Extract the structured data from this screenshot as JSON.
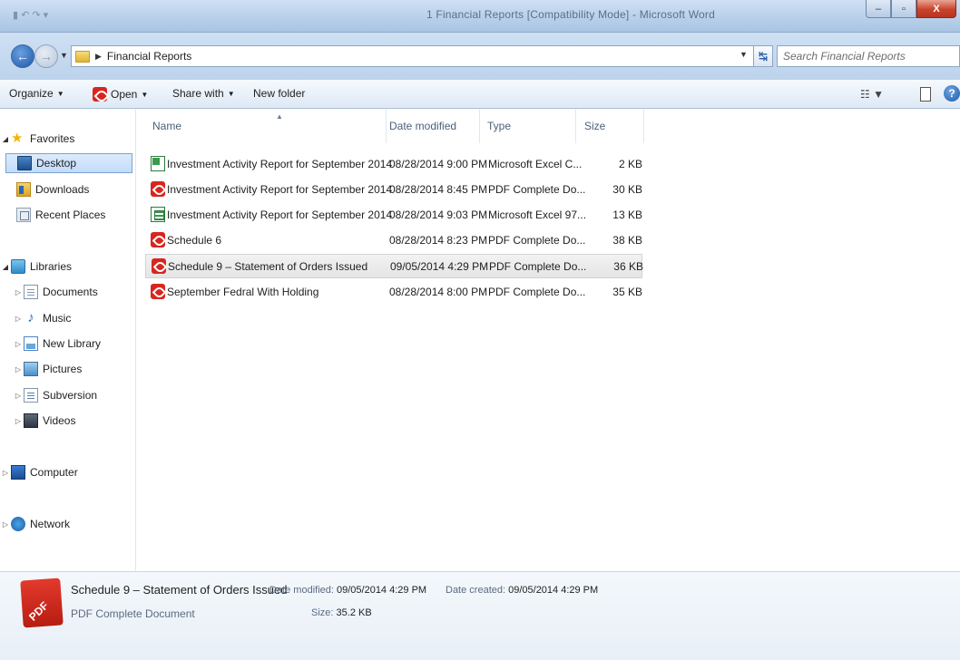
{
  "window": {
    "doc_title": "1 Financial Reports [Compatibility Mode] - Microsoft Word",
    "minimize": "–",
    "maximize": "▫",
    "close": "X"
  },
  "address": {
    "path": "Financial Reports",
    "search_placeholder": "Search Financial Reports"
  },
  "commands": {
    "organize": "Organize",
    "open": "Open",
    "share_with": "Share with",
    "new_folder": "New folder"
  },
  "nav": {
    "favorites": "Favorites",
    "desktop": "Desktop",
    "downloads": "Downloads",
    "recent_places": "Recent Places",
    "libraries": "Libraries",
    "documents": "Documents",
    "music": "Music",
    "new_library": "New Library",
    "pictures": "Pictures",
    "subversion": "Subversion",
    "videos": "Videos",
    "computer": "Computer",
    "network": "Network"
  },
  "columns": {
    "name": "Name",
    "date_modified": "Date modified",
    "type": "Type",
    "size": "Size"
  },
  "files": [
    {
      "name": "Investment Activity Report for September 2014",
      "date": "08/28/2014 9:00 PM",
      "type": "Microsoft Excel C...",
      "size": "2 KB",
      "icon": "excel-csv-icon"
    },
    {
      "name": "Investment Activity Report for September 2014",
      "date": "08/28/2014 8:45 PM",
      "type": "PDF Complete Do...",
      "size": "30 KB",
      "icon": "pdf-icon"
    },
    {
      "name": "Investment Activity Report for September 2014",
      "date": "08/28/2014 9:03 PM",
      "type": "Microsoft Excel 97...",
      "size": "13 KB",
      "icon": "excel-97-icon"
    },
    {
      "name": "Schedule 6",
      "date": "08/28/2014 8:23 PM",
      "type": "PDF Complete Do...",
      "size": "38 KB",
      "icon": "pdf-icon"
    },
    {
      "name": "Schedule 9 – Statement of Orders Issued",
      "date": "09/05/2014 4:29 PM",
      "type": "PDF Complete Do...",
      "size": "36 KB",
      "icon": "pdf-icon"
    },
    {
      "name": "September Fedral With Holding",
      "date": "08/28/2014 8:00 PM",
      "type": "PDF Complete Do...",
      "size": "35 KB",
      "icon": "pdf-icon"
    }
  ],
  "details": {
    "name": "Schedule 9 – Statement of Orders Issued",
    "date_modified_label": "Date modified:",
    "date_modified": "09/05/2014 4:29 PM",
    "date_created_label": "Date created:",
    "date_created": "09/05/2014 4:29 PM",
    "type": "PDF Complete Document",
    "size_label": "Size:",
    "size": "35.2 KB",
    "icon_text": "PDF"
  },
  "colors": {
    "accent": "#1d58a8",
    "selection": "#c1dcfc",
    "pdf_red": "#d7261e"
  }
}
